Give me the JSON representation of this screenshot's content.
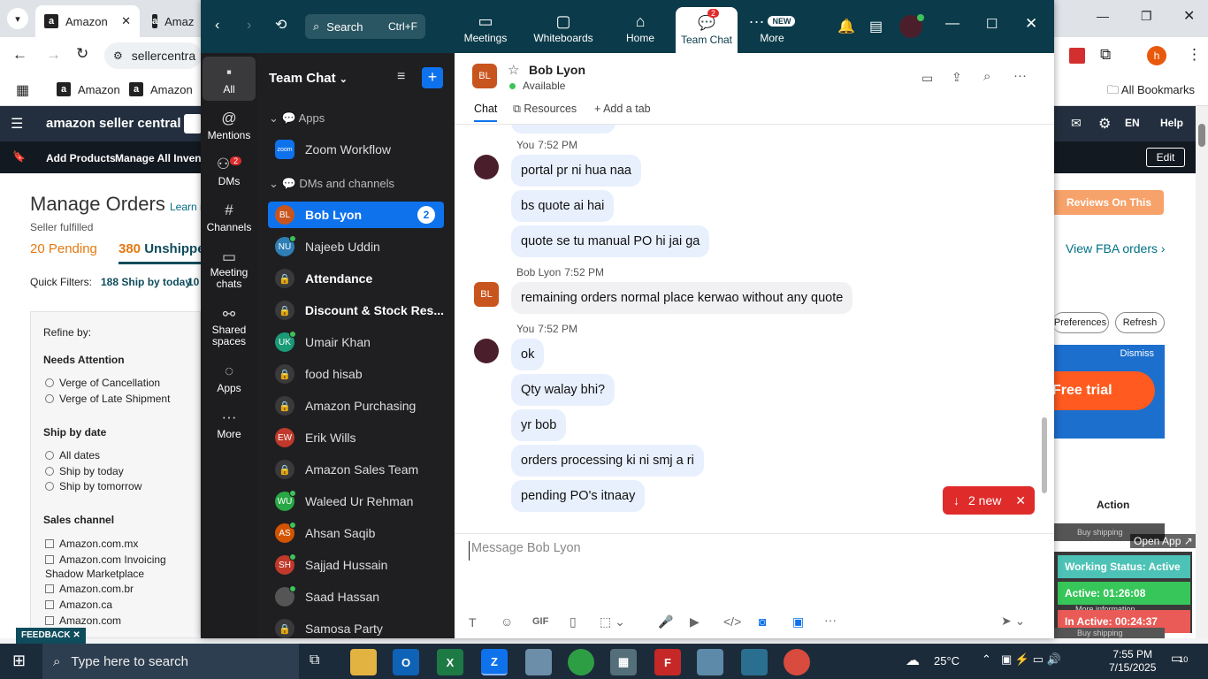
{
  "browser": {
    "tabs": [
      {
        "label": "Amazon",
        "fav": "a"
      },
      {
        "label": "Amaz",
        "fav": "a"
      }
    ],
    "address": "sellercentra",
    "bookmarks": [
      "Amazon",
      "Amazon"
    ],
    "all_bookmarks": "All Bookmarks"
  },
  "amazon": {
    "logo": "amazon seller central",
    "nav_right": {
      "lang": "EN",
      "help": "Help"
    },
    "sub_nav": [
      "Add Products",
      "Manage All Inventor"
    ],
    "edit": "Edit",
    "page_title": "Manage Orders",
    "learn_more": "Learn m",
    "fulfilled": "Seller fulfilled",
    "pending": "20 Pending",
    "unshipped_count": "380",
    "unshipped_label": "Unshippe",
    "quick_filters_label": "Quick Filters:",
    "quick_filter": "188 Ship by today",
    "quick_filter_count": "10",
    "refine_by": "Refine by:",
    "needs_attention": "Needs Attention",
    "na_options": [
      "Verge of Cancellation",
      "Verge of Late Shipment"
    ],
    "ship_by_date": "Ship by date",
    "sbd_options": [
      "All dates",
      "Ship by today",
      "Ship by tomorrow"
    ],
    "sales_channel": "Sales channel",
    "sc_options": [
      "Amazon.com.mx",
      "Amazon.com Invoicing Shadow Marketplace",
      "Amazon.com.br",
      "Amazon.ca",
      "Amazon.com"
    ],
    "feedback": "FEEDBACK",
    "reviews_button": "Reviews On This Page",
    "view_fba": "View FBA orders",
    "preferences": "Preferences",
    "refresh": "Refresh",
    "dismiss": "Dismiss",
    "free_trial": "Free trial",
    "action_header": "Action",
    "buy_shipping": "Buy shipping",
    "open_app": "Open App",
    "more_info": "More information",
    "working_status": "Working Status: Active",
    "active_time": "Active: 01:26:08",
    "inactive_time": "In Active: 00:24:37"
  },
  "zoom": {
    "search_label": "Search",
    "search_shortcut": "Ctrl+F",
    "tabs": [
      {
        "label": "Meetings",
        "icon": "video-icon"
      },
      {
        "label": "Whiteboards",
        "icon": "whiteboard-icon"
      },
      {
        "label": "Home",
        "icon": "home-icon"
      },
      {
        "label": "Team Chat",
        "icon": "chat-icon",
        "badge": "2"
      },
      {
        "label": "More",
        "icon": "more-icon",
        "badge": "NEW"
      }
    ],
    "rail": [
      {
        "label": "All"
      },
      {
        "label": "Mentions"
      },
      {
        "label": "DMs",
        "badge": "2"
      },
      {
        "label": "Channels"
      },
      {
        "label": "Meeting chats"
      },
      {
        "label": "Shared spaces"
      },
      {
        "label": "Apps"
      },
      {
        "label": "More"
      }
    ],
    "list_title": "Team Chat",
    "section_apps": "Apps",
    "app_item": "Zoom Workflow",
    "section_dms": "DMs and channels",
    "items": [
      {
        "name": "Bob Lyon",
        "initials": "BL",
        "color": "#c8541e",
        "badge": "2",
        "bold": true,
        "online": false
      },
      {
        "name": "Najeeb Uddin",
        "initials": "NU",
        "color": "#2f7fb5",
        "online": true
      },
      {
        "name": "Attendance",
        "lock": true,
        "bold": true
      },
      {
        "name": "Discount & Stock Res...",
        "lock": true,
        "bold": true
      },
      {
        "name": "Umair Khan",
        "initials": "UK",
        "color": "#1a9a77",
        "online": true
      },
      {
        "name": "food hisab",
        "lock": true
      },
      {
        "name": "Amazon Purchasing",
        "lock": true
      },
      {
        "name": "Erik Wills",
        "initials": "EW",
        "color": "#c0392b",
        "online": false
      },
      {
        "name": "Amazon Sales Team",
        "lock": true
      },
      {
        "name": "Waleed Ur Rehman",
        "initials": "WU",
        "color": "#28a745",
        "online": true
      },
      {
        "name": "Ahsan Saqib",
        "initials": "AS",
        "color": "#d35400",
        "online": true
      },
      {
        "name": "Sajjad Hussain",
        "initials": "SH",
        "color": "#c0392b",
        "online": true
      },
      {
        "name": "Saad Hassan",
        "initials": "",
        "color": "#555",
        "online": true
      },
      {
        "name": "Samosa Party",
        "lock": true
      }
    ],
    "chat": {
      "contact": "Bob Lyon",
      "initials": "BL",
      "status": "Available",
      "tabs": [
        "Chat",
        "Resources",
        "Add a tab"
      ],
      "groups": [
        {
          "sender": "You",
          "time": "7:52 PM",
          "mine": true,
          "messages": [
            "portal pr ni hua naa",
            "bs quote ai hai",
            "quote se tu manual PO hi jai ga"
          ]
        },
        {
          "sender": "Bob Lyon",
          "time": "7:52 PM",
          "mine": false,
          "messages": [
            "remaining orders normal place kerwao without any quote"
          ]
        },
        {
          "sender": "You",
          "time": "7:52 PM",
          "mine": true,
          "messages": [
            "ok",
            "Qty walay bhi?",
            "yr bob",
            "orders processing ki ni smj a ri",
            "pending PO's itnaay"
          ]
        }
      ],
      "new_pill": "2 new",
      "composer_placeholder": "Message Bob Lyon"
    }
  },
  "taskbar": {
    "search_placeholder": "Type here to search",
    "weather": "25°C",
    "time": "7:55 PM",
    "date": "7/15/2025",
    "notif_count": "10"
  }
}
